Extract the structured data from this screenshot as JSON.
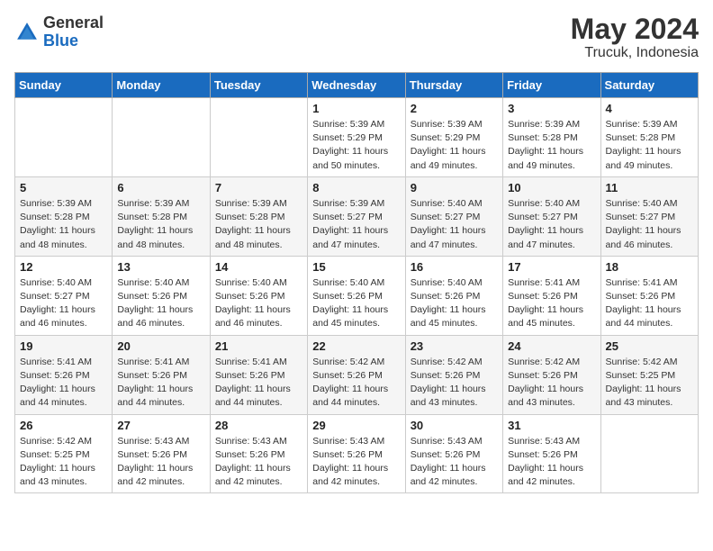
{
  "header": {
    "logo_general": "General",
    "logo_blue": "Blue",
    "month_year": "May 2024",
    "location": "Trucuk, Indonesia"
  },
  "days_of_week": [
    "Sunday",
    "Monday",
    "Tuesday",
    "Wednesday",
    "Thursday",
    "Friday",
    "Saturday"
  ],
  "weeks": [
    [
      {
        "day": "",
        "info": ""
      },
      {
        "day": "",
        "info": ""
      },
      {
        "day": "",
        "info": ""
      },
      {
        "day": "1",
        "info": "Sunrise: 5:39 AM\nSunset: 5:29 PM\nDaylight: 11 hours and 50 minutes."
      },
      {
        "day": "2",
        "info": "Sunrise: 5:39 AM\nSunset: 5:29 PM\nDaylight: 11 hours and 49 minutes."
      },
      {
        "day": "3",
        "info": "Sunrise: 5:39 AM\nSunset: 5:28 PM\nDaylight: 11 hours and 49 minutes."
      },
      {
        "day": "4",
        "info": "Sunrise: 5:39 AM\nSunset: 5:28 PM\nDaylight: 11 hours and 49 minutes."
      }
    ],
    [
      {
        "day": "5",
        "info": "Sunrise: 5:39 AM\nSunset: 5:28 PM\nDaylight: 11 hours and 48 minutes."
      },
      {
        "day": "6",
        "info": "Sunrise: 5:39 AM\nSunset: 5:28 PM\nDaylight: 11 hours and 48 minutes."
      },
      {
        "day": "7",
        "info": "Sunrise: 5:39 AM\nSunset: 5:28 PM\nDaylight: 11 hours and 48 minutes."
      },
      {
        "day": "8",
        "info": "Sunrise: 5:39 AM\nSunset: 5:27 PM\nDaylight: 11 hours and 47 minutes."
      },
      {
        "day": "9",
        "info": "Sunrise: 5:40 AM\nSunset: 5:27 PM\nDaylight: 11 hours and 47 minutes."
      },
      {
        "day": "10",
        "info": "Sunrise: 5:40 AM\nSunset: 5:27 PM\nDaylight: 11 hours and 47 minutes."
      },
      {
        "day": "11",
        "info": "Sunrise: 5:40 AM\nSunset: 5:27 PM\nDaylight: 11 hours and 46 minutes."
      }
    ],
    [
      {
        "day": "12",
        "info": "Sunrise: 5:40 AM\nSunset: 5:27 PM\nDaylight: 11 hours and 46 minutes."
      },
      {
        "day": "13",
        "info": "Sunrise: 5:40 AM\nSunset: 5:26 PM\nDaylight: 11 hours and 46 minutes."
      },
      {
        "day": "14",
        "info": "Sunrise: 5:40 AM\nSunset: 5:26 PM\nDaylight: 11 hours and 46 minutes."
      },
      {
        "day": "15",
        "info": "Sunrise: 5:40 AM\nSunset: 5:26 PM\nDaylight: 11 hours and 45 minutes."
      },
      {
        "day": "16",
        "info": "Sunrise: 5:40 AM\nSunset: 5:26 PM\nDaylight: 11 hours and 45 minutes."
      },
      {
        "day": "17",
        "info": "Sunrise: 5:41 AM\nSunset: 5:26 PM\nDaylight: 11 hours and 45 minutes."
      },
      {
        "day": "18",
        "info": "Sunrise: 5:41 AM\nSunset: 5:26 PM\nDaylight: 11 hours and 44 minutes."
      }
    ],
    [
      {
        "day": "19",
        "info": "Sunrise: 5:41 AM\nSunset: 5:26 PM\nDaylight: 11 hours and 44 minutes."
      },
      {
        "day": "20",
        "info": "Sunrise: 5:41 AM\nSunset: 5:26 PM\nDaylight: 11 hours and 44 minutes."
      },
      {
        "day": "21",
        "info": "Sunrise: 5:41 AM\nSunset: 5:26 PM\nDaylight: 11 hours and 44 minutes."
      },
      {
        "day": "22",
        "info": "Sunrise: 5:42 AM\nSunset: 5:26 PM\nDaylight: 11 hours and 44 minutes."
      },
      {
        "day": "23",
        "info": "Sunrise: 5:42 AM\nSunset: 5:26 PM\nDaylight: 11 hours and 43 minutes."
      },
      {
        "day": "24",
        "info": "Sunrise: 5:42 AM\nSunset: 5:26 PM\nDaylight: 11 hours and 43 minutes."
      },
      {
        "day": "25",
        "info": "Sunrise: 5:42 AM\nSunset: 5:25 PM\nDaylight: 11 hours and 43 minutes."
      }
    ],
    [
      {
        "day": "26",
        "info": "Sunrise: 5:42 AM\nSunset: 5:25 PM\nDaylight: 11 hours and 43 minutes."
      },
      {
        "day": "27",
        "info": "Sunrise: 5:43 AM\nSunset: 5:26 PM\nDaylight: 11 hours and 42 minutes."
      },
      {
        "day": "28",
        "info": "Sunrise: 5:43 AM\nSunset: 5:26 PM\nDaylight: 11 hours and 42 minutes."
      },
      {
        "day": "29",
        "info": "Sunrise: 5:43 AM\nSunset: 5:26 PM\nDaylight: 11 hours and 42 minutes."
      },
      {
        "day": "30",
        "info": "Sunrise: 5:43 AM\nSunset: 5:26 PM\nDaylight: 11 hours and 42 minutes."
      },
      {
        "day": "31",
        "info": "Sunrise: 5:43 AM\nSunset: 5:26 PM\nDaylight: 11 hours and 42 minutes."
      },
      {
        "day": "",
        "info": ""
      }
    ]
  ]
}
